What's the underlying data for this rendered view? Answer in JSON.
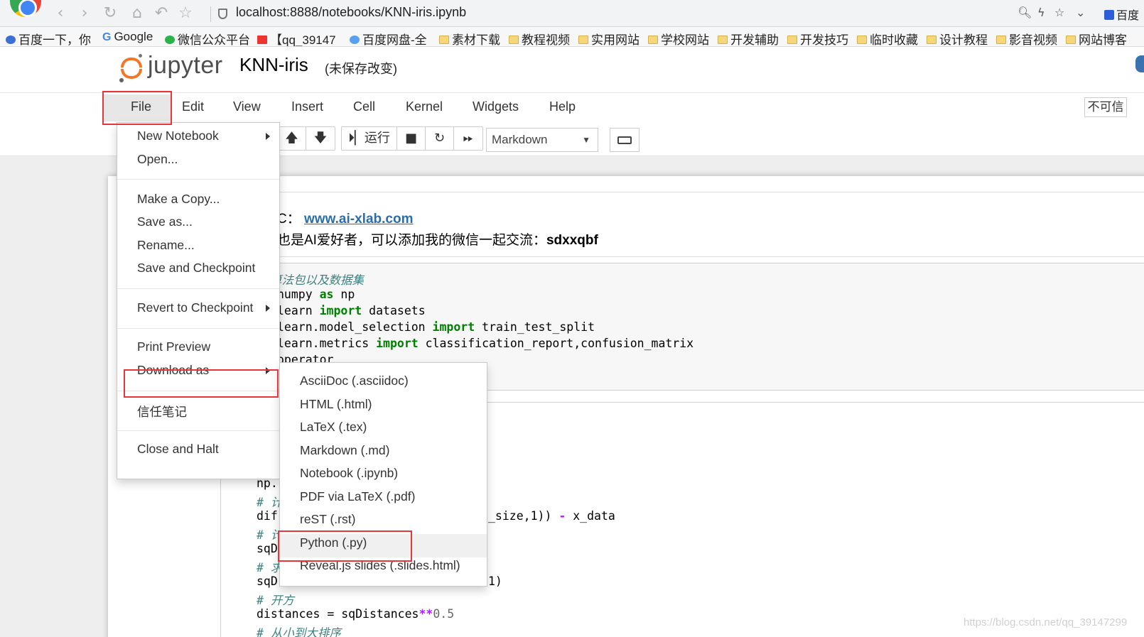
{
  "browser": {
    "url": "localhost:8888/notebooks/KNN-iris.ipynb",
    "right_tab_label": "百度",
    "bookmarks": [
      "百度一下，你",
      "Google",
      "微信公众平台",
      "【qq_39147",
      "百度网盘-全",
      "素材下载",
      "教程视频",
      "实用网站",
      "学校网站",
      "开发辅助",
      "开发技巧",
      "临时收藏",
      "设计教程",
      "影音视频",
      "网站博客"
    ]
  },
  "header": {
    "logo_text": "jupyter",
    "notebook_name": "KNN-iris",
    "save_status": "(未保存改变)"
  },
  "menubar": {
    "items": [
      "File",
      "Edit",
      "View",
      "Insert",
      "Cell",
      "Kernel",
      "Widgets",
      "Help"
    ],
    "trust_label": "不可信"
  },
  "toolbar": {
    "run_label": "运行",
    "cell_type": "Markdown"
  },
  "file_menu": {
    "items": [
      "New Notebook",
      "Open...",
      "Make a Copy...",
      "Save as...",
      "Rename...",
      "Save and Checkpoint",
      "Revert to Checkpoint",
      "Print Preview",
      "Download as",
      "信任笔记",
      "Close and Halt"
    ]
  },
  "download_menu": {
    "items": [
      "AsciiDoc (.asciidoc)",
      "HTML (.html)",
      "LaTeX (.tex)",
      "Markdown (.md)",
      "Notebook (.ipynb)",
      "PDF via LaTeX (.pdf)",
      "reST (.rst)",
      "Python (.py)",
      "Reveal.js slides (.slides.html)"
    ]
  },
  "markdown_cell": {
    "line1_prefix": "C：",
    "link": "www.ai-xlab.com",
    "line2_text": "也是AI爱好者，可以添加我的微信一起交流：",
    "line2_bold": "sdxxqbf"
  },
  "code_cell_1": {
    "comment": "算法包以及数据集",
    "line2_a": "numpy ",
    "line2_kw": "as",
    "line2_b": " np",
    "line3_a": "learn ",
    "line3_kw": "import",
    "line3_b": " datasets",
    "line4_a": "learn.model_selection ",
    "line4_kw": "import",
    "line4_b": " train_test_split",
    "line5_a": "learn.metrics ",
    "line5_kw": "import",
    "line5_b": " classification_report,confusion_matrix",
    "line6": "operator"
  },
  "code_cell_2": {
    "l1": "np.",
    "l2": "# 计",
    "l3_a": "dif",
    "l3_b": "_size,1)) ",
    "l3_op": "-",
    "l3_c": " x_data",
    "l4": "# 计",
    "l5": "sqD",
    "l6": "# 求",
    "l7_a": "sqD",
    "l7_b": "1)",
    "l8": "# 开方",
    "l9_a": "distances = sqDistances",
    "l9_op": "**",
    "l9_num": "0.5",
    "l10": "# 从小到大排序"
  },
  "watermark": "https://blog.csdn.net/qq_39147299",
  "colors": {
    "jupyter_orange": "#f37726",
    "highlight_red": "#e4363b",
    "link_blue": "#296eaa",
    "keyword_green": "#008000"
  }
}
